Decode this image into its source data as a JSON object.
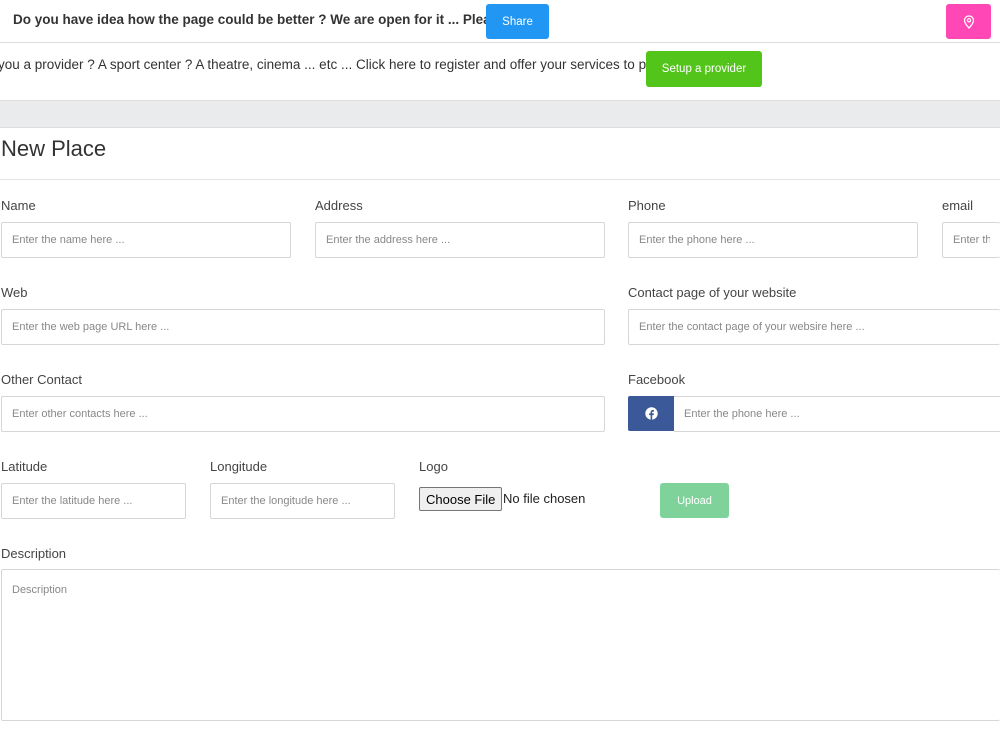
{
  "topbar": {
    "feedback_text": "Do you have idea how the page could be better ? We are open for it ... Please",
    "share_label": "Share",
    "map_icon": "map-pin-icon"
  },
  "provider": {
    "text": "you a provider ? A sport center ? A theatre, cinema ... etc ... Click here to register and offer your services to people:",
    "setup_label": "Setup a provider"
  },
  "form": {
    "title": "New Place",
    "name": {
      "label": "Name",
      "placeholder": "Enter the name here ..."
    },
    "address": {
      "label": "Address",
      "placeholder": "Enter the address here ..."
    },
    "phone": {
      "label": "Phone",
      "placeholder": "Enter the phone here ..."
    },
    "email": {
      "label": "email",
      "placeholder": "Enter the"
    },
    "web": {
      "label": "Web",
      "placeholder": "Enter the web page URL here ..."
    },
    "contact_page": {
      "label": "Contact page of your website",
      "placeholder": "Enter the contact page of your websire here ..."
    },
    "other_contact": {
      "label": "Other Contact",
      "placeholder": "Enter other contacts here ..."
    },
    "facebook": {
      "label": "Facebook",
      "placeholder": "Enter the phone here ...",
      "icon": "facebook-icon"
    },
    "latitude": {
      "label": "Latitude",
      "placeholder": "Enter the latitude here ..."
    },
    "longitude": {
      "label": "Longitude",
      "placeholder": "Enter the longitude here ..."
    },
    "logo": {
      "label": "Logo",
      "choose_label": "Choose File",
      "status": "No file chosen"
    },
    "upload_label": "Upload",
    "description": {
      "label": "Description",
      "placeholder": "Description"
    }
  },
  "colors": {
    "share": "#2196f3",
    "map_button": "#ff47b5",
    "setup": "#52c41a",
    "facebook": "#3b5998",
    "upload": "#7fd39a"
  }
}
